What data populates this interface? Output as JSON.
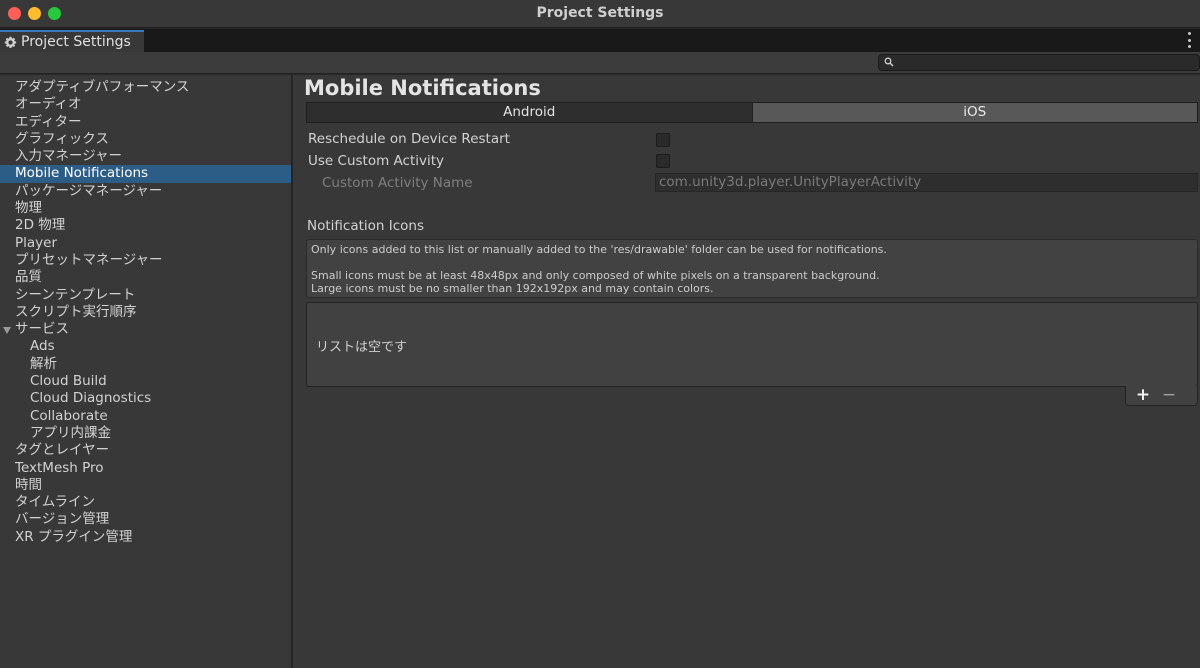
{
  "window": {
    "title": "Project Settings"
  },
  "tab": {
    "label": "Project Settings"
  },
  "sidebar": {
    "items": [
      "アダプティブパフォーマンス",
      "オーディオ",
      "エディター",
      "グラフィックス",
      "入力マネージャー",
      "Mobile Notifications",
      "パッケージマネージャー",
      "物理",
      "2D 物理",
      "Player",
      "プリセットマネージャー",
      "品質",
      "シーンテンプレート",
      "スクリプト実行順序",
      "サービス",
      "Ads",
      "解析",
      "Cloud Build",
      "Cloud Diagnostics",
      "Collaborate",
      "アプリ内課金",
      "タグとレイヤー",
      "TextMesh Pro",
      "時間",
      "タイムライン",
      "バージョン管理",
      "XR プラグイン管理"
    ]
  },
  "main": {
    "title": "Mobile Notifications",
    "platform_tabs": [
      "Android",
      "iOS"
    ],
    "reschedule_label": "Reschedule on Device Restart",
    "custom_activity_label": "Use Custom Activity",
    "custom_activity_name_label": "Custom Activity Name",
    "custom_activity_name_value": "com.unity3d.player.UnityPlayerActivity",
    "notification_icons_label": "Notification Icons",
    "help_line1": "Only icons added to this list or manually added to the 'res/drawable' folder can be used for notifications.",
    "help_line2": "Small icons must be at least 48x48px and only composed of white pixels on a transparent background.",
    "help_line3": "Large icons must be no smaller than 192x192px and may contain colors.",
    "list_empty": "リストは空です",
    "add_symbol": "+",
    "remove_symbol": "−"
  },
  "colors": {
    "selected": "#2c5d87",
    "tab_accent": "#3a79bb"
  }
}
